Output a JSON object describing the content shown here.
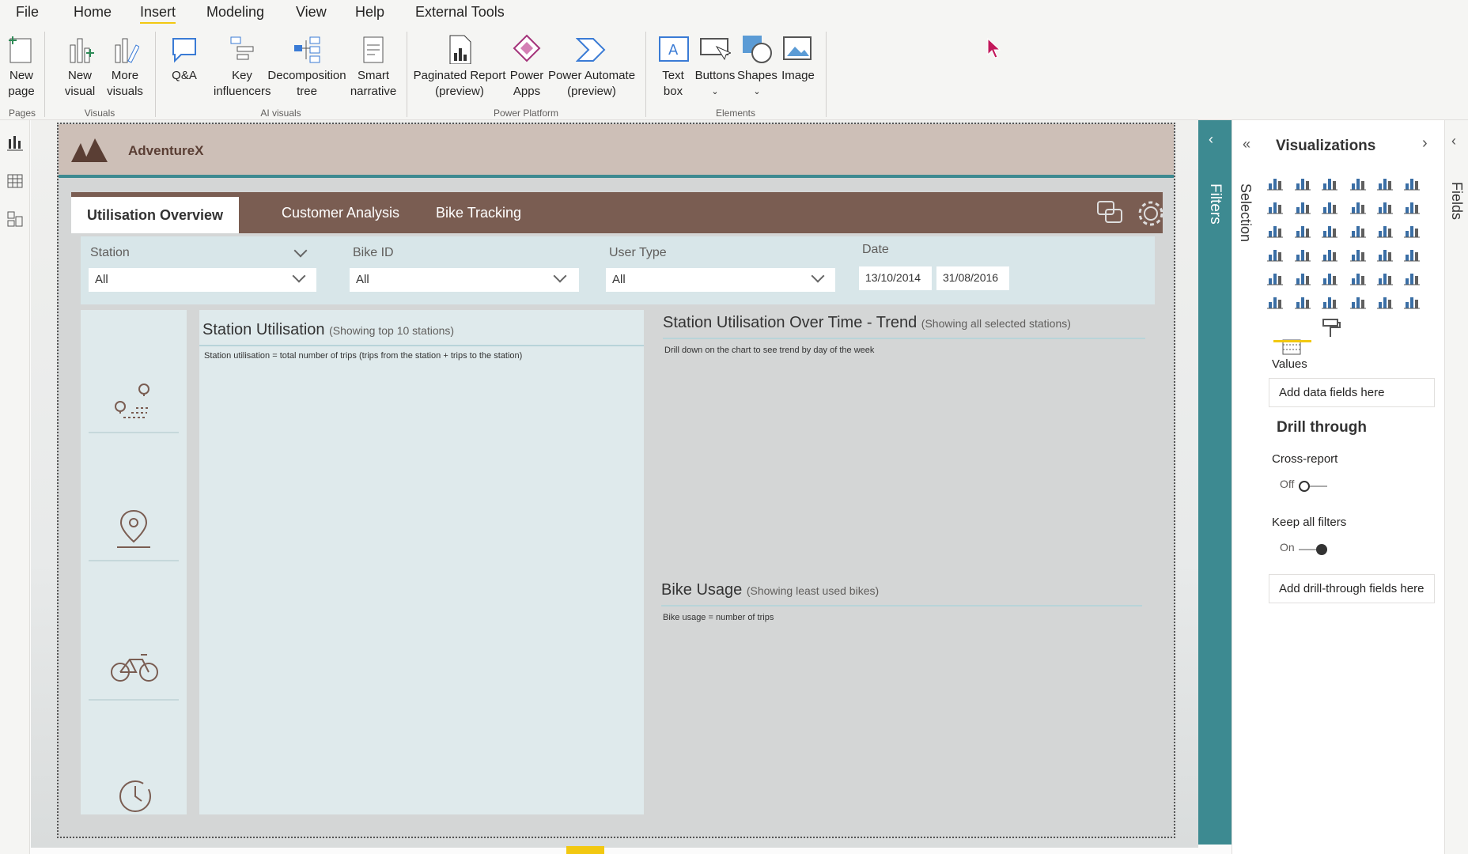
{
  "menu": {
    "file": "File",
    "home": "Home",
    "insert": "Insert",
    "modeling": "Modeling",
    "view": "View",
    "help": "Help",
    "external_tools": "External Tools"
  },
  "ribbon": {
    "new_page": [
      "New",
      "page"
    ],
    "new_visual": [
      "New",
      "visual"
    ],
    "more_visuals": [
      "More",
      "visuals"
    ],
    "qa": "Q&A",
    "key_influencers": [
      "Key",
      "influencers"
    ],
    "decomposition_tree": [
      "Decomposition",
      "tree"
    ],
    "smart_narrative": [
      "Smart",
      "narrative"
    ],
    "paginated_report": [
      "Paginated Report",
      "(preview)"
    ],
    "power_apps": [
      "Power",
      "Apps"
    ],
    "power_automate": [
      "Power Automate",
      "(preview)"
    ],
    "text_box": [
      "Text",
      "box"
    ],
    "buttons": "Buttons",
    "shapes": "Shapes",
    "image": "Image",
    "groups": {
      "pages": "Pages",
      "visuals": "Visuals",
      "ai_visuals": "AI visuals",
      "power_platform": "Power Platform",
      "elements": "Elements"
    }
  },
  "report": {
    "brand": "AdventureX",
    "tabs": [
      "Utilisation Overview",
      "Customer Analysis",
      "Bike Tracking"
    ],
    "filters": {
      "station_label": "Station",
      "station_value": "All",
      "bike_label": "Bike ID",
      "bike_value": "All",
      "user_label": "User Type",
      "user_value": "All",
      "date_label": "Date",
      "date_from": "13/10/2014",
      "date_to": "31/08/2016"
    },
    "visuals": [
      {
        "title": "Station Utilisation",
        "subtitle": "(Showing top 10 stations)",
        "note": "Station utilisation = total number of trips (trips from the station + trips to the station)"
      },
      {
        "title": "Station Utilisation Over Time - Trend",
        "subtitle": "(Showing all selected stations)",
        "note": "Drill down on the chart to see trend by day of the week"
      },
      {
        "title": "Bike Usage",
        "subtitle": "(Showing least used bikes)",
        "note": "Bike usage = number of trips"
      }
    ]
  },
  "panes": {
    "filters": "Filters",
    "selection": "Selection",
    "visualizations": "Visualizations",
    "fields": "Fields",
    "values_label": "Values",
    "values_placeholder": "Add data fields here",
    "drill_through": "Drill through",
    "cross_report": "Cross-report",
    "cross_report_state": "Off",
    "keep_filters": "Keep all filters",
    "keep_filters_state": "On",
    "drill_placeholder": "Add drill-through fields here"
  }
}
